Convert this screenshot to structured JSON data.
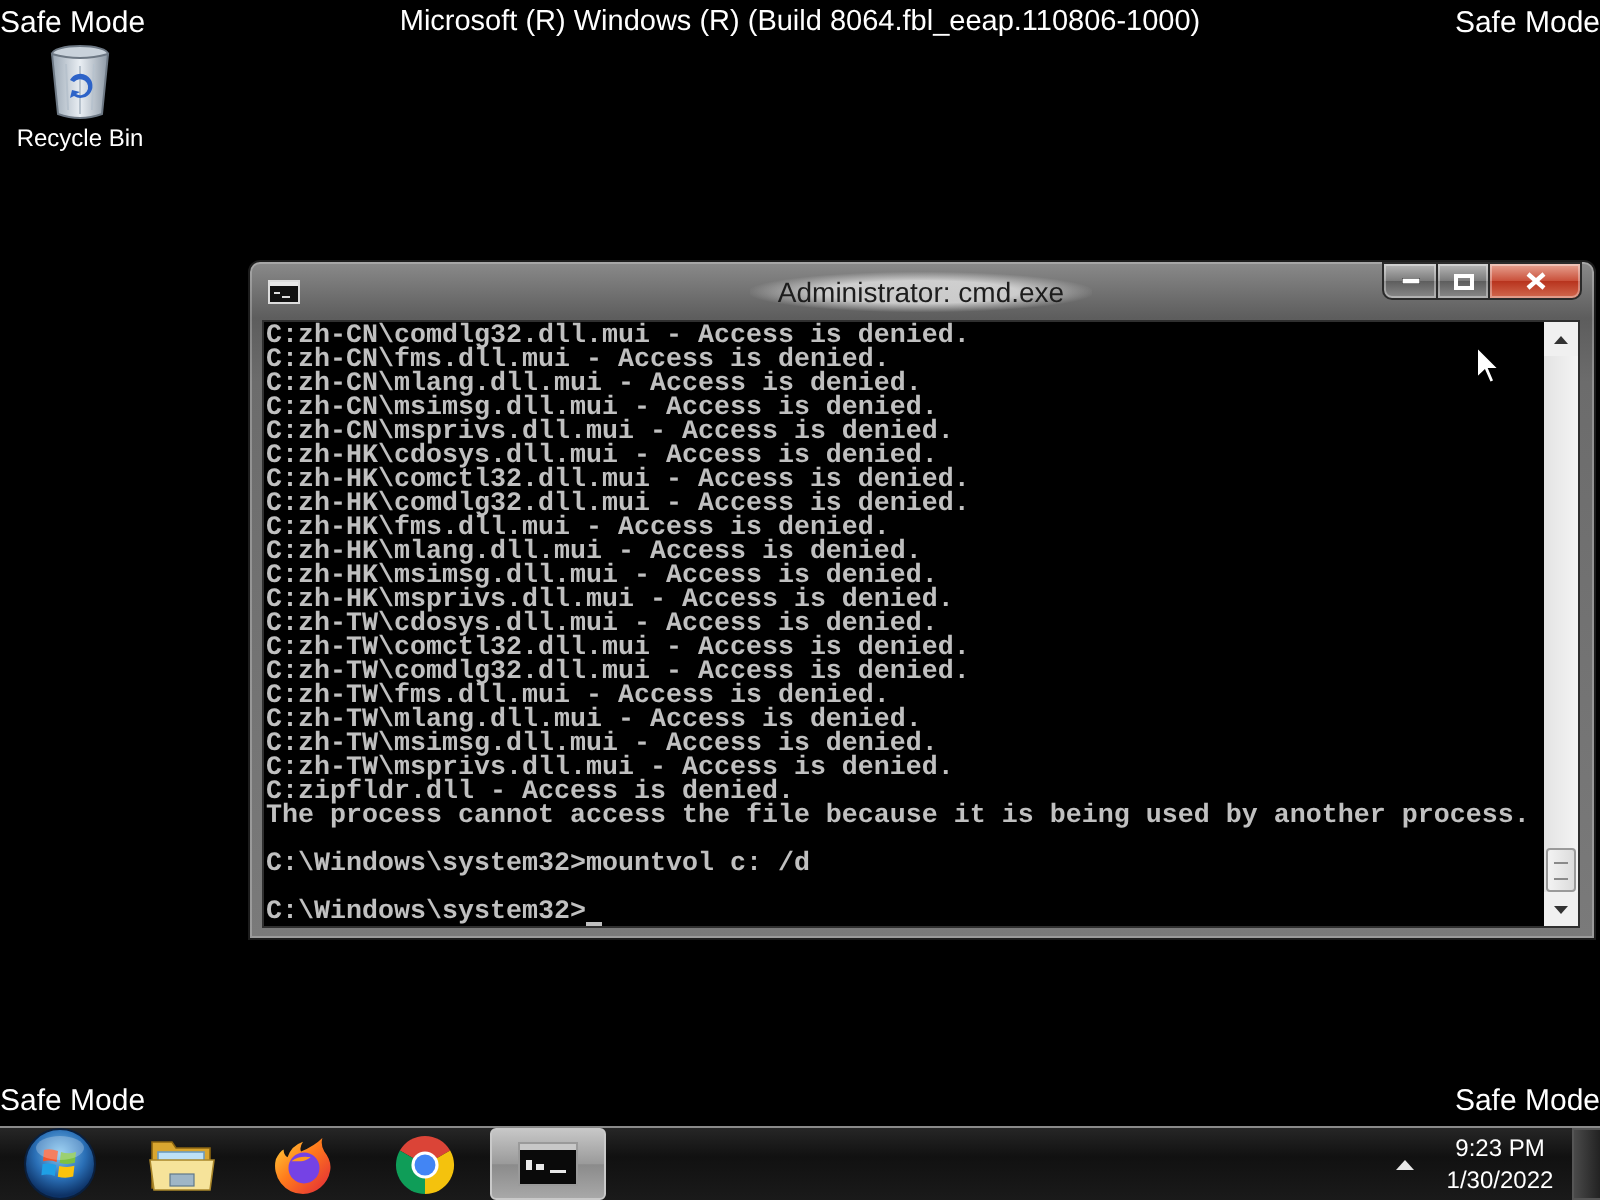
{
  "top_bar": {
    "left_label": "Safe Mode",
    "title": "Microsoft (R) Windows (R) (Build 8064.fbl_eeap.110806-1000)",
    "right_label": "Safe Mode"
  },
  "desktop_icons": [
    {
      "kind": "recycle_bin",
      "label": "Recycle Bin"
    }
  ],
  "window": {
    "title": "Administrator: cmd.exe",
    "output_lines": [
      "C:zh-CN\\comdlg32.dll.mui - Access is denied.",
      "C:zh-CN\\fms.dll.mui - Access is denied.",
      "C:zh-CN\\mlang.dll.mui - Access is denied.",
      "C:zh-CN\\msimsg.dll.mui - Access is denied.",
      "C:zh-CN\\msprivs.dll.mui - Access is denied.",
      "C:zh-HK\\cdosys.dll.mui - Access is denied.",
      "C:zh-HK\\comctl32.dll.mui - Access is denied.",
      "C:zh-HK\\comdlg32.dll.mui - Access is denied.",
      "C:zh-HK\\fms.dll.mui - Access is denied.",
      "C:zh-HK\\mlang.dll.mui - Access is denied.",
      "C:zh-HK\\msimsg.dll.mui - Access is denied.",
      "C:zh-HK\\msprivs.dll.mui - Access is denied.",
      "C:zh-TW\\cdosys.dll.mui - Access is denied.",
      "C:zh-TW\\comctl32.dll.mui - Access is denied.",
      "C:zh-TW\\comdlg32.dll.mui - Access is denied.",
      "C:zh-TW\\fms.dll.mui - Access is denied.",
      "C:zh-TW\\mlang.dll.mui - Access is denied.",
      "C:zh-TW\\msimsg.dll.mui - Access is denied.",
      "C:zh-TW\\msprivs.dll.mui - Access is denied.",
      "C:zipfldr.dll - Access is denied.",
      "The process cannot access the file because it is being used by another process."
    ],
    "commands": [
      {
        "text": "C:\\Windows\\system32>mountvol c: /d",
        "cursor": false
      },
      {
        "text": "C:\\Windows\\system32>",
        "cursor": true
      }
    ]
  },
  "bottom_bar": {
    "left_label": "Safe Mode",
    "right_label": "Safe Mode"
  },
  "taskbar": {
    "items": [
      {
        "kind": "explorer",
        "selected": false
      },
      {
        "kind": "firefox",
        "selected": false
      },
      {
        "kind": "chrome",
        "selected": false
      },
      {
        "kind": "cmd",
        "selected": true
      }
    ],
    "clock": {
      "time": "9:23 PM",
      "date": "1/30/2022"
    }
  }
}
